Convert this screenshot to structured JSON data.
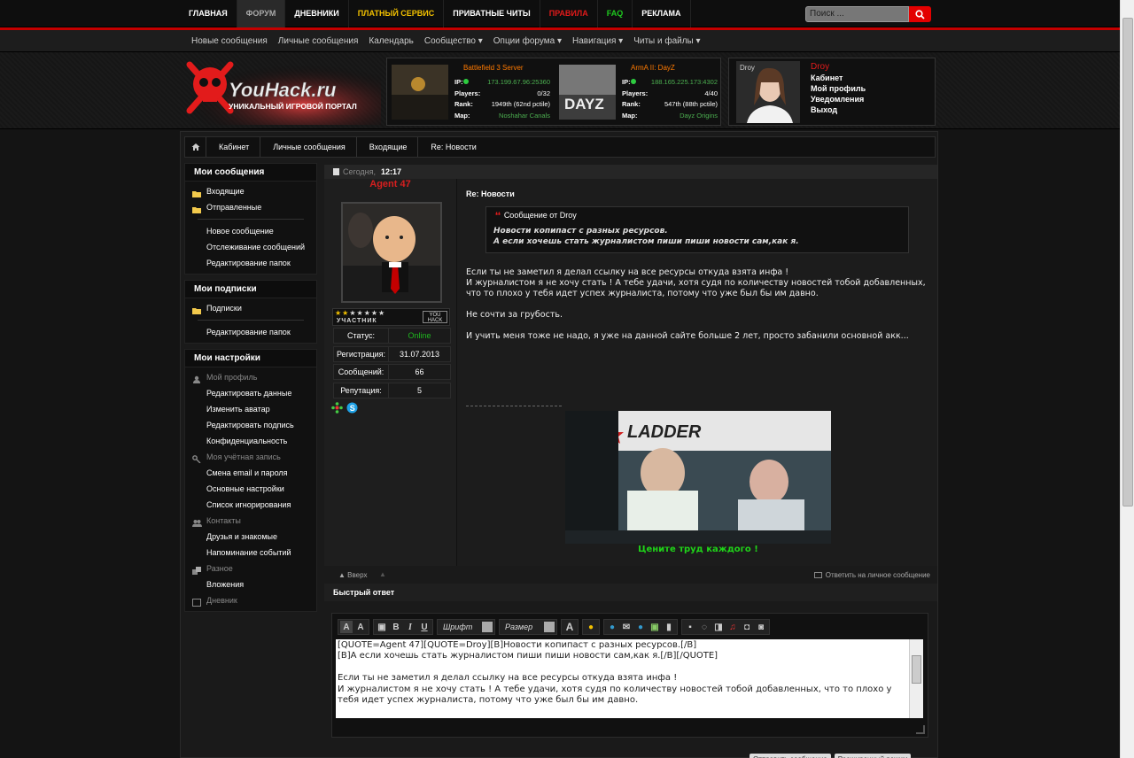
{
  "topnav": {
    "items": [
      {
        "label": "ГЛАВНАЯ",
        "color": "#ffffff",
        "active": false
      },
      {
        "label": "ФОРУМ",
        "color": "#aaaaaa",
        "active": true
      },
      {
        "label": "ДНЕВНИКИ",
        "color": "#ffffff",
        "active": false
      },
      {
        "label": "ПЛАТНЫЙ СЕРВИС",
        "color": "#f2c000",
        "active": false
      },
      {
        "label": "ПРИВАТНЫЕ ЧИТЫ",
        "color": "#ffffff",
        "active": false
      },
      {
        "label": "ПРАВИЛА",
        "color": "#e01a1a",
        "active": false
      },
      {
        "label": "FAQ",
        "color": "#1fc91f",
        "active": false
      },
      {
        "label": "РЕКЛАМА",
        "color": "#ffffff",
        "active": false
      }
    ],
    "search_placeholder": "Поиск ..."
  },
  "subnav": {
    "items": [
      "Новые сообщения",
      "Личные сообщения",
      "Календарь",
      "Сообщество ▾",
      "Опции форума ▾",
      "Навигация ▾",
      "Читы и файлы ▾"
    ]
  },
  "logo": {
    "text": "YouHack.ru",
    "tagline": "УНИКАЛЬНЫЙ ИГРОВОЙ ПОРТАЛ"
  },
  "servers": [
    {
      "name": "Battlefield 3 Server",
      "ip_label": "IP:",
      "ip": "173.199.67.96:25360",
      "players_label": "Players:",
      "players": "0/32",
      "rank_label": "Rank:",
      "rank": "1949th (62nd pctile)",
      "map_label": "Map:",
      "map": "Noshahar Canals"
    },
    {
      "name": "ArmA II: DayZ",
      "ip_label": "IP:",
      "ip": "188.165.225.173:4302",
      "players_label": "Players:",
      "players": "4/40",
      "rank_label": "Rank:",
      "rank": "547th (88th pctile)",
      "map_label": "Map:",
      "map": "Dayz Origins",
      "img_text": "DAYZ"
    }
  ],
  "userbox": {
    "avatar_caption": "Droy",
    "username": "Droy",
    "links": [
      "Кабинет",
      "Мой профиль",
      "Уведомления",
      "Выход"
    ]
  },
  "breadcrumbs": [
    "Кабинет",
    "Личные сообщения",
    "Входящие",
    "Re: Новости"
  ],
  "sidebar": {
    "blocks": [
      {
        "title": "Мои сообщения",
        "items": [
          {
            "label": "Входящие",
            "icon": "folder"
          },
          {
            "label": "Отправленные",
            "icon": "folder"
          },
          {
            "sep": true
          },
          {
            "label": "Новое сообщение"
          },
          {
            "label": "Отслеживание сообщений"
          },
          {
            "label": "Редактирование папок"
          }
        ]
      },
      {
        "title": "Мои подписки",
        "items": [
          {
            "label": "Подписки",
            "icon": "folder"
          },
          {
            "sep": true
          },
          {
            "label": "Редактирование папок"
          }
        ]
      },
      {
        "title": "Мои настройки",
        "items": [
          {
            "label": "Мой профиль",
            "sub": true,
            "icon": "user"
          },
          {
            "label": "Редактировать данные"
          },
          {
            "label": "Изменить аватар"
          },
          {
            "label": "Редактировать подпись"
          },
          {
            "label": "Конфиденциальность"
          },
          {
            "label": "Моя учётная запись",
            "sub": true,
            "icon": "key"
          },
          {
            "label": "Смена email и пароля"
          },
          {
            "label": "Основные настройки"
          },
          {
            "label": "Список игнорирования"
          },
          {
            "label": "Контакты",
            "sub": true,
            "icon": "users"
          },
          {
            "label": "Друзья и знакомые"
          },
          {
            "label": "Напоминание событий"
          },
          {
            "label": "Разное",
            "sub": true,
            "icon": "misc"
          },
          {
            "label": "Вложения"
          },
          {
            "label": "Дневник",
            "sub": true,
            "icon": "book"
          }
        ]
      }
    ]
  },
  "post": {
    "date_label": "Сегодня,",
    "time": "12:17",
    "author": "Agent 47",
    "rank_title": "УЧАСТНИК",
    "rank_badge": "YOU HACK",
    "stars": 7,
    "stats": [
      {
        "label": "Статус:",
        "value": "Online",
        "color": "#1fb81f"
      },
      {
        "label": "Регистрация:",
        "value": "31.07.2013",
        "color": "#ffffff"
      },
      {
        "label": "Сообщений:",
        "value": "66",
        "color": "#ffffff"
      },
      {
        "label": "Репутация:",
        "value": "5",
        "color": "#ffffff"
      }
    ],
    "title": "Re: Новости",
    "quote_header": "Сообщение от Droy",
    "quote_lines": [
      "Новости копипаст с разных ресурсов.",
      "А если хочешь стать журналистом пиши пиши новости сам,как я."
    ],
    "body": [
      "Если ты не заметил я делал ссылку на все ресурсы откуда взята инфа !\nИ журналистом я не хочу стать ! А тебе удачи, хотя судя по количеству новостей тобой добавленных, что то плохо у тебя идет успех журналиста, потому что уже был бы им давно.",
      "Не сочти за грубость.",
      "И учить меня тоже не надо, я уже на данной сайте больше 2 лет, просто забанили основной акк..."
    ],
    "sig_banner": "LADDER",
    "sig_caption": "Цените труд каждого !",
    "up_label": "Вверх",
    "reply_label": "Ответить на личное сообщение"
  },
  "quick_reply": {
    "title": "Быстрый ответ",
    "font_label": "Шрифт",
    "size_label": "Размер",
    "text": "[QUOTE=Agent 47][QUOTE=Droy][B]Новости копипаст с разных ресурсов.[/B]\n[B]А если хочешь стать журналистом пиши пиши новости сам,как я.[/B][/QUOTE]\n\nЕсли ты не заметил я делал ссылку на все ресурсы откуда взята инфа !\nИ журналистом я не хочу стать ! А тебе удачи, хотя судя по количеству новостей тобой добавленных, что то плохо у тебя идет успех журналиста, потому что уже был бы им давно.",
    "buttons": [
      "Отправить сообщение",
      "Расширенный режим"
    ]
  },
  "colors": {
    "accent": "#c40000",
    "link_green": "#1fc91f"
  }
}
